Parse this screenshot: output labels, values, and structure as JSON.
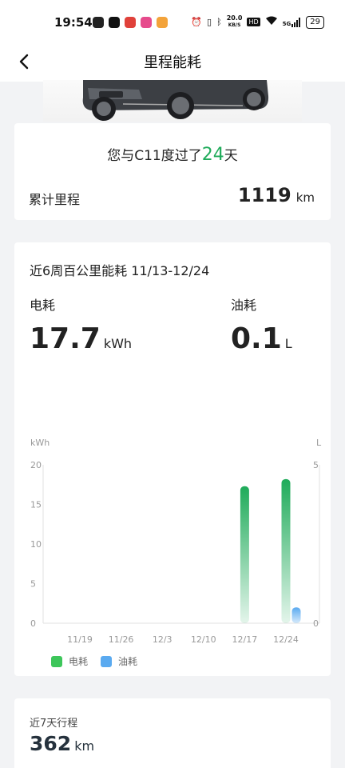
{
  "status_bar": {
    "time": "19:54",
    "net_speed_top": "20.0",
    "net_speed_unit": "KB/S",
    "hd": "HD",
    "signal": "5G",
    "battery": "29"
  },
  "nav": {
    "title": "里程能耗",
    "back_icon": "chevron-left-icon"
  },
  "summary": {
    "together_prefix": "您与C11度过了",
    "together_days": "24",
    "together_suffix": "天",
    "mileage_label": "累计里程",
    "mileage_value": "1119",
    "mileage_unit": "km"
  },
  "energy": {
    "period_label": "近6周百公里能耗 11/13-12/24",
    "electric_label": "电耗",
    "electric_value": "17.7",
    "electric_unit": "kWh",
    "oil_label": "油耗",
    "oil_value": "0.1",
    "oil_unit": "L"
  },
  "chart_data": {
    "type": "bar",
    "categories": [
      "11/19",
      "11/26",
      "12/3",
      "12/10",
      "12/17",
      "12/24"
    ],
    "series": [
      {
        "name": "电耗",
        "axis": "left",
        "values": [
          0,
          0,
          0,
          0,
          17.3,
          18.2
        ],
        "color": "#1fab5a"
      },
      {
        "name": "油耗",
        "axis": "right",
        "values": [
          0,
          0,
          0,
          0,
          0,
          0.5
        ],
        "color": "#5aaaf0"
      }
    ],
    "y_left": {
      "label": "kWh",
      "ticks": [
        0,
        5,
        10,
        15,
        20
      ],
      "range": [
        0,
        20
      ]
    },
    "y_right": {
      "label": "L",
      "ticks": [
        0,
        5
      ],
      "range": [
        0,
        5
      ]
    },
    "legend_position": "bottom-left"
  },
  "weekly": {
    "label": "近7天行程",
    "value": "362",
    "unit": "km"
  }
}
